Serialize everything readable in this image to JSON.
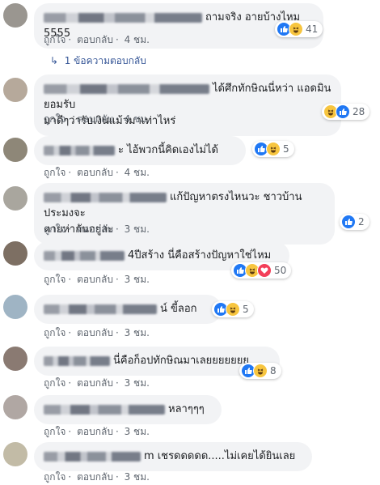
{
  "actions": {
    "like": "ถูกใจ",
    "sep": "·",
    "reply": "ตอบกลับ"
  },
  "reply_link": {
    "label": "1 ข้อความตอบกลับ"
  },
  "comments": [
    {
      "text": "ถามจริง อายบ้างไหม 5555",
      "reactions": [
        "like",
        "haha"
      ],
      "count": "41",
      "time": "4 ชม."
    },
    {
      "text": "ได้ศึกทักษิณนี่หว่า แอดมินยอมรับ\nมาดีๆว่ารับเงินแม้วมาเท่าไหร่",
      "reactions": [
        "haha",
        "like"
      ],
      "count": "28",
      "time": "4 ชม."
    },
    {
      "text": "ะ ไอ้พวกนี้คิดเองไม่ได้",
      "reactions": [
        "like",
        "haha"
      ],
      "count": "5",
      "time": "4 ชม."
    },
    {
      "text": "แก้ปัญหาตรงไหนวะ ชาวบ้านประมงจะ\nตายห่ากันอยู่ล่ะ",
      "reactions": [
        "like"
      ],
      "count": "2",
      "time": "3 ชม."
    },
    {
      "text": "4ปีสร้าง นี่คือสร้างปัญหาใช่ไหม",
      "reactions": [
        "like",
        "haha",
        "love"
      ],
      "count": "50",
      "time": "3 ชม."
    },
    {
      "text": "น์ ขี้ลอก",
      "reactions": [
        "like",
        "haha"
      ],
      "count": "5",
      "time": "3 ชม."
    },
    {
      "text": "นี่คือก็อปทักษิณมาเลยยยยยยย",
      "reactions": [
        "like",
        "haha"
      ],
      "count": "8",
      "time": "3 ชม."
    },
    {
      "text": "หลาๆๆๆ",
      "reactions": [],
      "count": "",
      "time": "3 ชม."
    },
    {
      "text": "m เชรดดดดด.....ไม่เคยได้ยินเลย",
      "reactions": [],
      "count": "",
      "time": "3 ชม."
    }
  ],
  "colors": {
    "link": "#385898",
    "meta": "#606770",
    "bubble": "#f2f3f5",
    "like": "#2078f4",
    "haha": "#f7c53f",
    "love": "#f33e58"
  }
}
